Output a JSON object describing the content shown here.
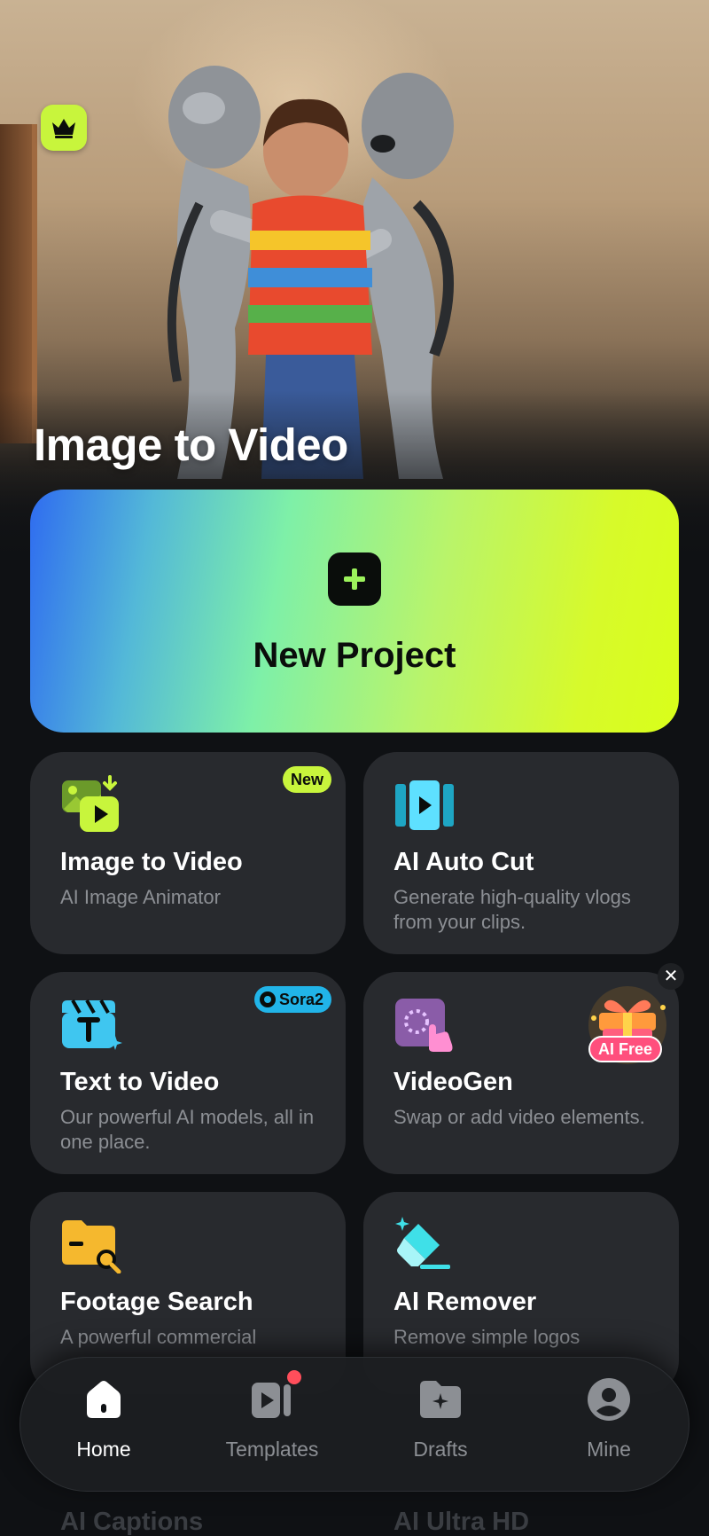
{
  "hero": {
    "title": "Image to Video",
    "crown_icon": "crown-icon"
  },
  "new_project": {
    "label": "New Project",
    "icon": "plus-icon"
  },
  "tools": [
    {
      "title": "Image to Video",
      "subtitle": "AI Image Animator",
      "badge": "New",
      "icon": "image-to-video-icon"
    },
    {
      "title": "AI Auto Cut",
      "subtitle": "Generate high-quality vlogs from your clips.",
      "icon": "film-play-icon"
    },
    {
      "title": "Text to Video",
      "subtitle": "Our powerful AI models, all in one place.",
      "badge": "Sora2",
      "icon": "text-clapper-icon"
    },
    {
      "title": "VideoGen",
      "subtitle": "Swap or add video elements.",
      "icon": "tap-select-icon"
    },
    {
      "title": "Footage Search",
      "subtitle": "A powerful commercial",
      "icon": "folder-search-icon"
    },
    {
      "title": "AI Remover",
      "subtitle": "Remove simple logos",
      "icon": "eraser-sparkle-icon"
    }
  ],
  "promo": {
    "label": "AI Free",
    "close": "✕"
  },
  "peek": {
    "left": "AI Captions",
    "right": "AI Ultra HD"
  },
  "nav": {
    "items": [
      {
        "label": "Home",
        "icon": "home-icon",
        "active": true
      },
      {
        "label": "Templates",
        "icon": "templates-icon"
      },
      {
        "label": "Drafts",
        "icon": "drafts-folder-icon"
      },
      {
        "label": "Mine",
        "icon": "profile-icon"
      }
    ]
  },
  "colors": {
    "accent_lime": "#c8f53c",
    "card_bg": "#282a2e",
    "page_bg": "#0f1114",
    "badge_blue": "#21b4e8",
    "notification_red": "#ff4e5b"
  }
}
